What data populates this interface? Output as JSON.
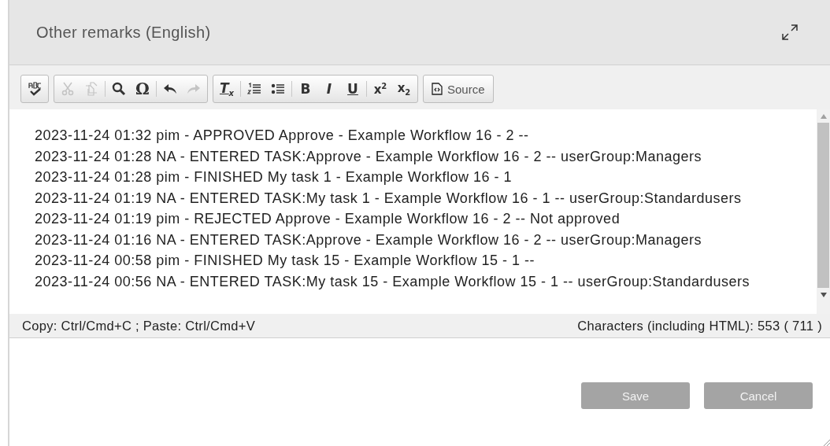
{
  "header": {
    "title": "Other remarks (English)"
  },
  "toolbar": [
    {
      "items": [
        {
          "kind": "spellcheck"
        }
      ]
    },
    {
      "items": [
        {
          "kind": "cut",
          "disabled": true
        },
        {
          "kind": "copy",
          "disabled": true
        },
        {
          "kind": "sep"
        },
        {
          "kind": "find",
          "disabled": false
        },
        {
          "kind": "glyph",
          "label": "Ω",
          "disabled": false
        },
        {
          "kind": "sep"
        },
        {
          "kind": "undo",
          "disabled": false
        },
        {
          "kind": "redo",
          "disabled": true
        }
      ]
    },
    {
      "items": [
        {
          "kind": "clearformat",
          "label": "T$_{x}$",
          "disabled": false
        },
        {
          "kind": "sep"
        },
        {
          "kind": "numbered",
          "disabled": false
        },
        {
          "kind": "bulleted",
          "disabled": false
        },
        {
          "kind": "sep"
        },
        {
          "kind": "bold",
          "label": "B",
          "disabled": false
        },
        {
          "kind": "italic",
          "label": "I",
          "disabled": false
        },
        {
          "kind": "underline",
          "label": "U",
          "disabled": false
        },
        {
          "kind": "sep"
        },
        {
          "kind": "script",
          "label": "x$^{2}$",
          "disabled": false
        },
        {
          "kind": "script",
          "label": "x$_{2}$",
          "disabled": false
        }
      ]
    },
    {
      "items": [
        {
          "kind": "source",
          "label": "Source"
        }
      ]
    }
  ],
  "content": {
    "lines": [
      "2023-11-24 01:32 pim - APPROVED Approve - Example Workflow 16 - 2 --",
      "2023-11-24 01:28 NA - ENTERED TASK:Approve - Example Workflow 16 - 2 -- userGroup:Managers",
      "2023-11-24 01:28 pim - FINISHED My task 1 - Example Workflow 16 - 1",
      "2023-11-24 01:19 NA - ENTERED TASK:My task 1 - Example Workflow 16 - 1 -- userGroup:Standardusers",
      "2023-11-24 01:19 pim - REJECTED Approve - Example Workflow 16 - 2 -- Not approved",
      "2023-11-24 01:16 NA - ENTERED TASK:Approve - Example Workflow 16 - 2 -- userGroup:Managers",
      "2023-11-24 00:58 pim - FINISHED My task 15 - Example Workflow 15 - 1 --",
      "2023-11-24 00:56 NA - ENTERED TASK:My task 15 - Example Workflow 15 - 1 -- userGroup:Standardusers"
    ]
  },
  "status_bar": {
    "hint": "Copy: Ctrl/Cmd+C ; Paste: Ctrl/Cmd+V",
    "count": "Characters (including HTML):  553 ( 711 )"
  },
  "buttons": [
    {
      "label": "Save",
      "disabled": true
    },
    {
      "label": "Cancel",
      "disabled": true
    }
  ]
}
